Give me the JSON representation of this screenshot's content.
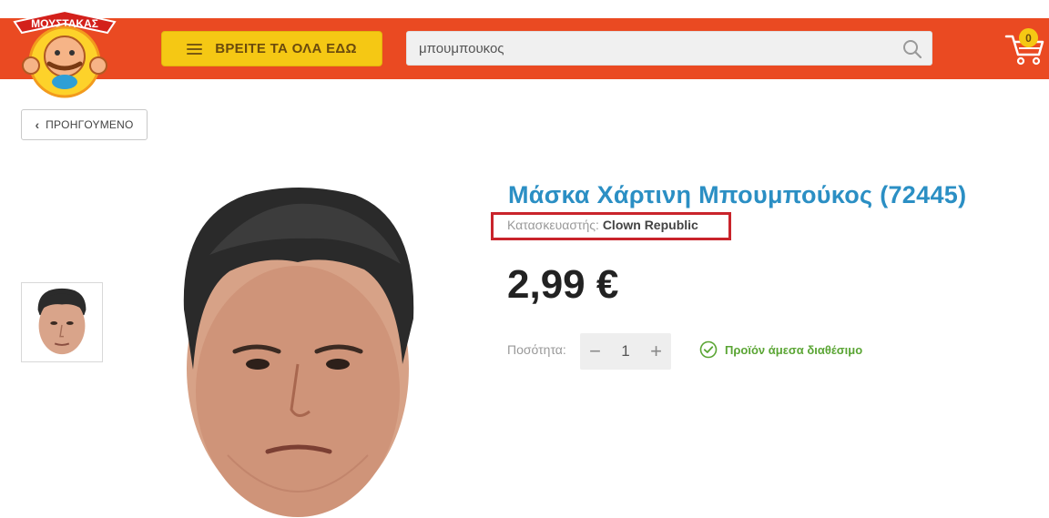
{
  "header": {
    "brand_text": "ΜΟΥΣΤΑΚΑΣ",
    "menu_label": "ΒΡΕΙΤΕ ΤΑ ΟΛΑ ΕΔΩ",
    "search_value": "μπουμπουκος",
    "cart_count": "0"
  },
  "nav": {
    "back_label": "ΠΡΟΗΓΟΥΜΕΝΟ"
  },
  "product": {
    "title": "Μάσκα Χάρτινη Μπουμπούκος (72445)",
    "manufacturer_label": "Κατασκευαστής:",
    "manufacturer_value": "Clown Republic",
    "price": "2,99 €",
    "quantity_label": "Ποσότητα:",
    "quantity_value": "1",
    "availability": "Προϊόν άμεσα διαθέσιμο"
  },
  "colors": {
    "header_bg": "#ea4a22",
    "menu_button": "#f5c814",
    "title": "#2b8fc4",
    "price": "#222222",
    "availability": "#5aa534",
    "highlight_box": "#c9242b"
  },
  "icons": {
    "menu": "hamburger-icon",
    "search": "magnifier-icon",
    "cart": "cart-icon",
    "back": "chevron-left-icon",
    "qty_minus": "minus-icon",
    "qty_plus": "plus-icon",
    "availability": "check-circle-icon"
  }
}
